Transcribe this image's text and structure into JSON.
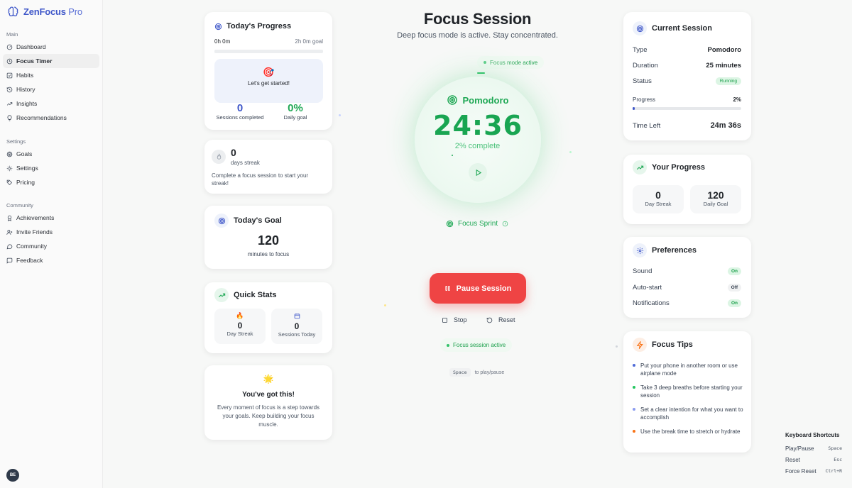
{
  "brand": {
    "name": "ZenFocus",
    "suffix": "Pro"
  },
  "sidebar": {
    "main_heading": "Main",
    "main_items": [
      {
        "label": "Dashboard",
        "icon": "dashboard-icon"
      },
      {
        "label": "Focus Timer",
        "icon": "clock-icon",
        "active": true
      },
      {
        "label": "Habits",
        "icon": "check-square-icon"
      },
      {
        "label": "History",
        "icon": "history-icon"
      },
      {
        "label": "Insights",
        "icon": "trend-icon"
      },
      {
        "label": "Recommendations",
        "icon": "bulb-icon"
      }
    ],
    "settings_heading": "Settings",
    "settings_items": [
      {
        "label": "Goals",
        "icon": "target-icon"
      },
      {
        "label": "Settings",
        "icon": "gear-icon"
      },
      {
        "label": "Pricing",
        "icon": "tag-icon"
      }
    ],
    "community_heading": "Community",
    "community_items": [
      {
        "label": "Achievements",
        "icon": "award-icon"
      },
      {
        "label": "Invite Friends",
        "icon": "user-plus-icon"
      },
      {
        "label": "Community",
        "icon": "chat-icon"
      },
      {
        "label": "Feedback",
        "icon": "message-icon"
      }
    ],
    "avatar_initials": "BE"
  },
  "todays_progress": {
    "title": "Today's Progress",
    "current": "0h 0m",
    "goal": "2h 0m goal",
    "progress": 0,
    "prompt": "Let's get started!",
    "sessions_value": "0",
    "sessions_label": "Sessions completed",
    "daily_goal_value": "0%",
    "daily_goal_label": "Daily goal"
  },
  "streak": {
    "value": "0",
    "label": "days streak",
    "message": "Complete a focus session to start your streak!"
  },
  "todays_goal": {
    "title": "Today's Goal",
    "value": "120",
    "label": "minutes to focus"
  },
  "quick_stats": {
    "title": "Quick Stats",
    "day_streak_value": "0",
    "day_streak_label": "Day Streak",
    "sessions_today_value": "0",
    "sessions_today_label": "Sessions Today"
  },
  "motivation": {
    "title": "You've got this!",
    "text": "Every moment of focus is a step towards your goals. Keep building your focus muscle."
  },
  "session": {
    "title": "Focus Session",
    "subtitle": "Deep focus mode is active. Stay concentrated.",
    "mode_badge": "Focus mode active",
    "mode": "Pomodoro",
    "time": "24:36",
    "percent": "2% complete",
    "sprint": "Focus Sprint",
    "pause_label": "Pause Session",
    "stop_label": "Stop",
    "reset_label": "Reset",
    "active_badge": "Focus session active",
    "hint_key": "Space",
    "hint_text": "to play/pause"
  },
  "current_session": {
    "title": "Current Session",
    "type_label": "Type",
    "type_value": "Pomodoro",
    "duration_label": "Duration",
    "duration_value": "25 minutes",
    "status_label": "Status",
    "status_value": "Running",
    "progress_label": "Progress",
    "progress_value": "2%",
    "progress": 0.02,
    "time_left_label": "Time Left",
    "time_left_value": "24m 36s"
  },
  "your_progress": {
    "title": "Your Progress",
    "day_streak_value": "0",
    "day_streak_label": "Day Streak",
    "daily_goal_value": "120",
    "daily_goal_label": "Daily Goal"
  },
  "preferences": {
    "title": "Preferences",
    "sound_label": "Sound",
    "sound_value": "On",
    "autostart_label": "Auto-start",
    "autostart_value": "Off",
    "notifications_label": "Notifications",
    "notifications_value": "On"
  },
  "focus_tips": {
    "title": "Focus Tips",
    "tips": [
      {
        "text": "Put your phone in another room or use airplane mode",
        "color": "#4f6bd8"
      },
      {
        "text": "Take 3 deep breaths before starting your session",
        "color": "#22c55e"
      },
      {
        "text": "Set a clear intention for what you want to accomplish",
        "color": "#8b9cf0"
      },
      {
        "text": "Use the break time to stretch or hydrate",
        "color": "#f97316"
      }
    ]
  },
  "shortcuts": {
    "title": "Keyboard Shortcuts",
    "items": [
      {
        "action": "Play/Pause",
        "key": "Space"
      },
      {
        "action": "Reset",
        "key": "Esc"
      },
      {
        "action": "Force Reset",
        "key": "Ctrl+R"
      }
    ]
  },
  "colors": {
    "accent": "#3f57c9",
    "success": "#1fa855",
    "danger": "#ef4444"
  }
}
